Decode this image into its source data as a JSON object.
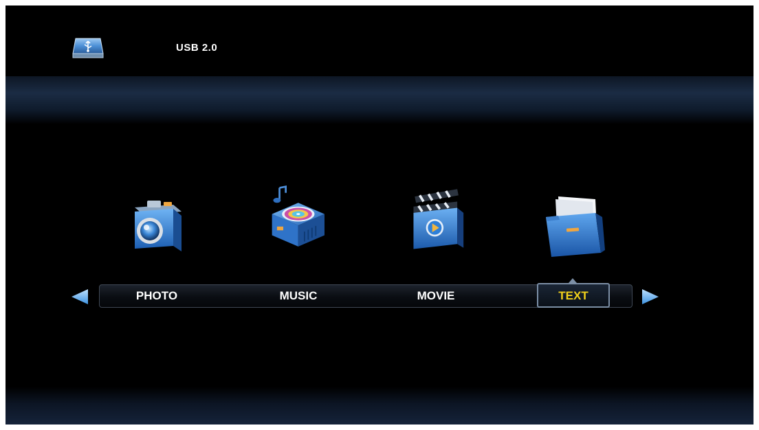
{
  "header": {
    "source_label": "USB 2.0",
    "source_icon": "usb-drive-icon"
  },
  "menu": {
    "items": [
      {
        "label": "PHOTO",
        "icon": "camera-icon"
      },
      {
        "label": "MUSIC",
        "icon": "music-disc-icon"
      },
      {
        "label": "MOVIE",
        "icon": "clapperboard-icon"
      },
      {
        "label": "TEXT",
        "icon": "document-folder-icon"
      }
    ],
    "selected": "TEXT",
    "prev_icon": "arrow-left-icon",
    "next_icon": "arrow-right-icon"
  },
  "colors": {
    "background": "#000000",
    "band": "#1b2c44",
    "selected_text": "#f2d21a",
    "label_text": "#ffffff",
    "icon_blue": "#2f7fd8",
    "arrow_blue": "#6fb6f0"
  }
}
